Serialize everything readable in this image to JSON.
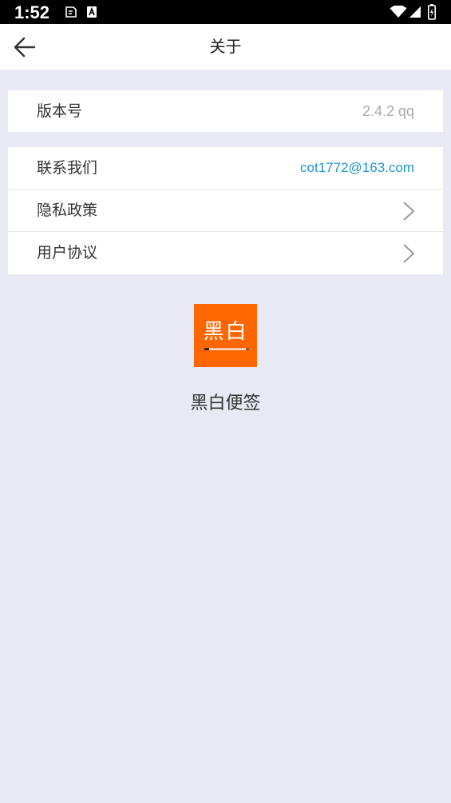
{
  "status_bar": {
    "time": "1:52"
  },
  "header": {
    "title": "关于"
  },
  "version_row": {
    "label": "版本号",
    "value": "2.4.2  qq"
  },
  "links": [
    {
      "label": "联系我们",
      "value": "cot1772@163.com"
    },
    {
      "label": "隐私政策"
    },
    {
      "label": "用户协议"
    }
  ],
  "app": {
    "logo_text": "黑白",
    "name": "黑白便签"
  },
  "colors": {
    "background": "#e9e9f4",
    "accent_logo": "#ff6600",
    "email_link": "#1e96c8",
    "muted": "#aaaaaa"
  },
  "icons": [
    "arrow-left-icon",
    "chevron-right-icon",
    "wifi-icon",
    "signal-icon",
    "battery-icon"
  ]
}
